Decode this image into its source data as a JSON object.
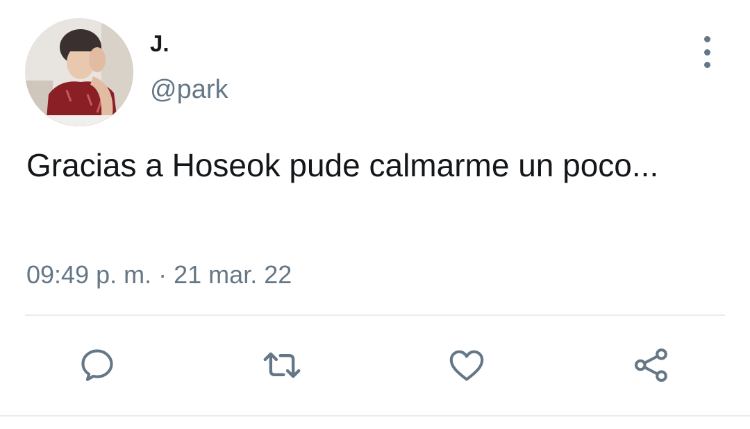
{
  "tweet": {
    "author": {
      "display_name": "J.",
      "handle": "@park"
    },
    "text": "Gracias a Hoseok pude calmarme un poco...",
    "time": "09:49 p. m.",
    "separator": "·",
    "date": "21 mar. 22",
    "menu_icon": "more-vertical-icon"
  },
  "actions": {
    "reply_icon": "reply-icon",
    "retweet_icon": "retweet-icon",
    "like_icon": "heart-icon",
    "share_icon": "share-icon"
  },
  "colors": {
    "text_primary": "#14171a",
    "text_secondary": "#657786",
    "divider": "#e6ecf0"
  }
}
